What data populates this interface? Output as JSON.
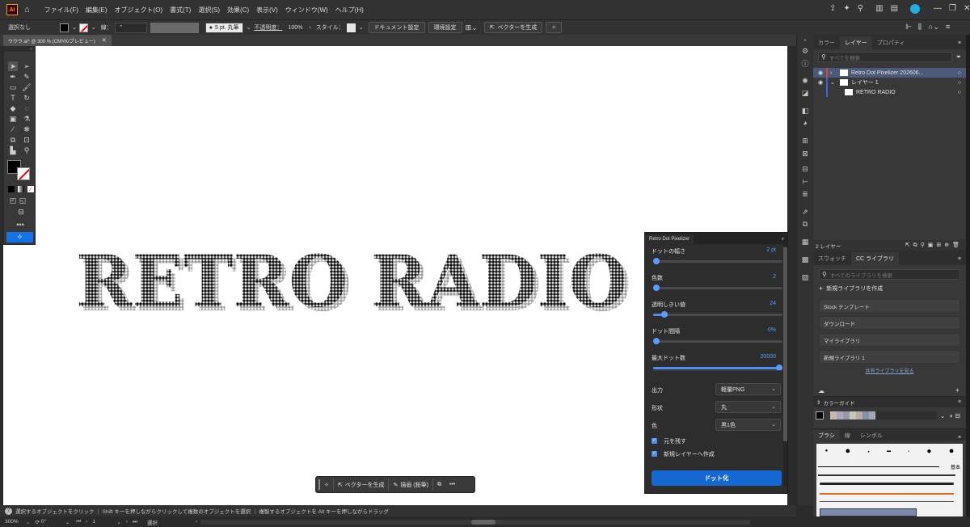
{
  "app": {
    "logo": "Ai"
  },
  "menu": [
    "ファイル(F)",
    "編集(E)",
    "オブジェクト(O)",
    "書式(T)",
    "選択(S)",
    "効果(C)",
    "表示(V)",
    "ウィンドウ(W)",
    "ヘルプ(H)"
  ],
  "control": {
    "selection": "選択なし",
    "stroke_label": "線：",
    "brush": "5 pt. 丸筆",
    "opacity_label": "不透明度：",
    "opacity": "100%",
    "style_label": "スタイル：",
    "doc_setup": "ドキュメント設定",
    "prefs": "環境設定",
    "vectorize": "ベクターを生成"
  },
  "document": {
    "tab": "ウウウ.ai* @ 300 % (CMYK/プレビュー)",
    "artwork_text": "RETRO RADIO"
  },
  "layers_panel": {
    "tabs": [
      "カラー",
      "レイヤー",
      "プロパティ"
    ],
    "search_placeholder": "すべてを検索",
    "rows": [
      {
        "name": "Retro Dot Pixelizer 202606...",
        "color": "#e04040"
      },
      {
        "name": "レイヤー 1",
        "color": "#4060e0"
      },
      {
        "name": "RETRO RADIO",
        "color": "#4060e0"
      }
    ],
    "count": "2 レイヤー"
  },
  "libraries": {
    "tabs": [
      "スウォッチ",
      "CC ライブラリ"
    ],
    "search_placeholder": "すべてのライブラリを検索",
    "new_library": "新規ライブラリを作成",
    "items": [
      "Stock テンプレート",
      "ダウンロード",
      "マイライブラリ",
      "新規ライブラリ 1"
    ],
    "link": "共有ライブラリを見る"
  },
  "color_guide": {
    "title": "カラーガイド",
    "swatches": [
      "#c8b8b0",
      "#a8a8b8",
      "#9a98a8",
      "#c0c8b8",
      "#b8a8a8",
      "#8890a8",
      "#a0a8b8"
    ]
  },
  "brushes": {
    "tabs": [
      "ブラシ",
      "線",
      "シンボル"
    ],
    "basic": "基本"
  },
  "plugin": {
    "title": "Retro Dot Pixelizer",
    "sliders": [
      {
        "label": "ドットの幅さ",
        "value": "2 pt",
        "fraction": 0.0
      },
      {
        "label": "色数",
        "value": "2",
        "fraction": 0.0
      },
      {
        "label": "透明しきい値",
        "value": "24",
        "fraction": 0.09
      },
      {
        "label": "ドット間隔",
        "value": "0%",
        "fraction": 0.0
      },
      {
        "label": "最大ドット数",
        "value": "20000",
        "fraction": 1.0
      }
    ],
    "selects": [
      {
        "label": "出力",
        "value": "軽量PNG"
      },
      {
        "label": "形状",
        "value": "丸"
      },
      {
        "label": "色",
        "value": "黒1色"
      }
    ],
    "checkboxes": [
      "元を残す",
      "新規レイヤーへ作成"
    ],
    "button": "ドット化"
  },
  "taskbar": {
    "vectorize": "ベクターを生成",
    "draw": "描画 (鉛筆)"
  },
  "status": {
    "text": "選択するオブジェクトをクリック ｜ Shift キーを押しながらクリックして複数のオブジェクトを選択 ｜ 複製するオブジェクトを Alt キーを押しながらドラッグ"
  },
  "bottom": {
    "zoom": "300%",
    "angle": "0°",
    "artboard": "1",
    "mode": "選択"
  }
}
